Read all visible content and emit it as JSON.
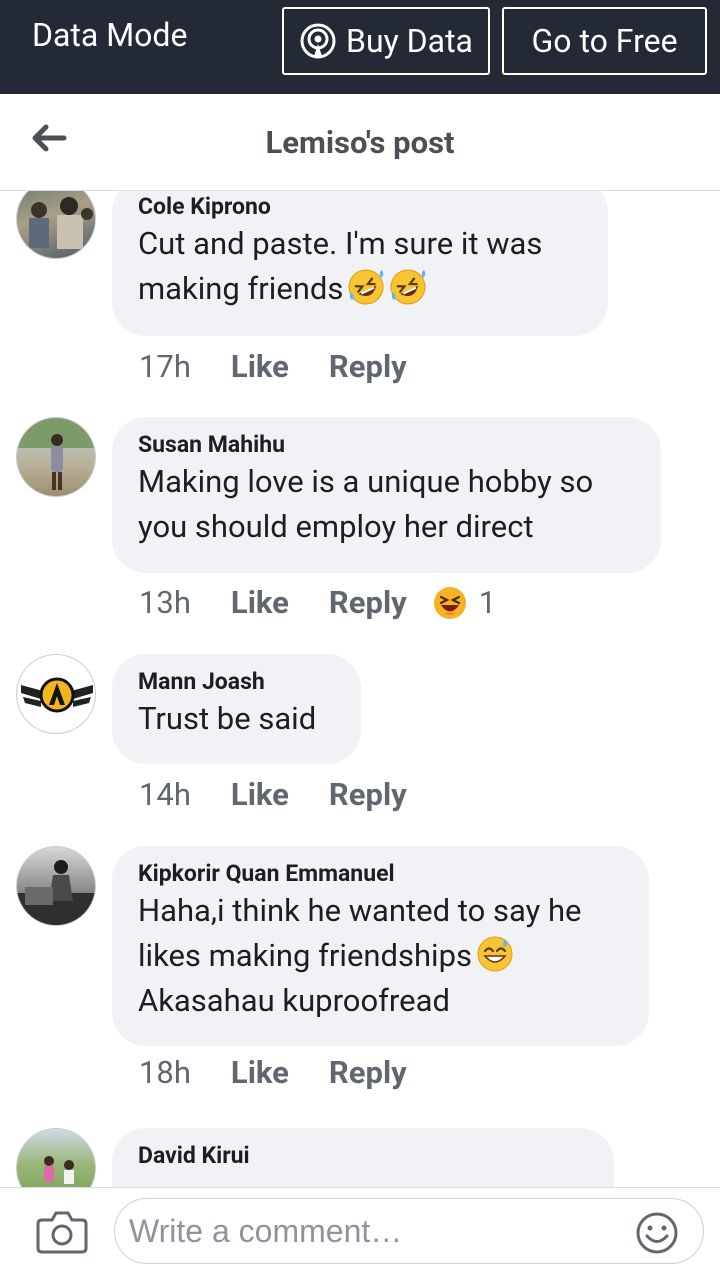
{
  "data_bar": {
    "mode_label": "Data Mode",
    "buy_label": "Buy Data",
    "free_label": "Go to Free"
  },
  "header": {
    "title": "Lemiso's post"
  },
  "comments": [
    {
      "author": "Cole Kiprono",
      "lines": [
        "Cut and paste. I'm sure it was",
        "making friends"
      ],
      "emoji": "rolling-on-floor-laughing-icon",
      "time": "17h",
      "like": "Like",
      "reply": "Reply"
    },
    {
      "author": "Susan Mahihu",
      "lines": [
        "Making love is a unique hobby so",
        "you should employ her direct"
      ],
      "time": "13h",
      "like": "Like",
      "reply": "Reply",
      "reaction": {
        "icon": "haha-reaction-icon",
        "count": "1"
      }
    },
    {
      "author": "Mann Joash",
      "lines": [
        "Trust be said"
      ],
      "time": "14h",
      "like": "Like",
      "reply": "Reply"
    },
    {
      "author": "Kipkorir Quan Emmanuel",
      "lines": [
        "Haha,i think he wanted to say he",
        "likes making friendships",
        "Akasahau kuproofread"
      ],
      "emoji": "grinning-sweat-icon",
      "time": "18h",
      "like": "Like",
      "reply": "Reply"
    },
    {
      "author": "David Kirui"
    }
  ],
  "composer": {
    "placeholder": "Write a comment…"
  },
  "colors": {
    "data_bar_bg": "#232a35",
    "bubble_bg": "#f0f2f5",
    "meta_text": "#606770"
  }
}
